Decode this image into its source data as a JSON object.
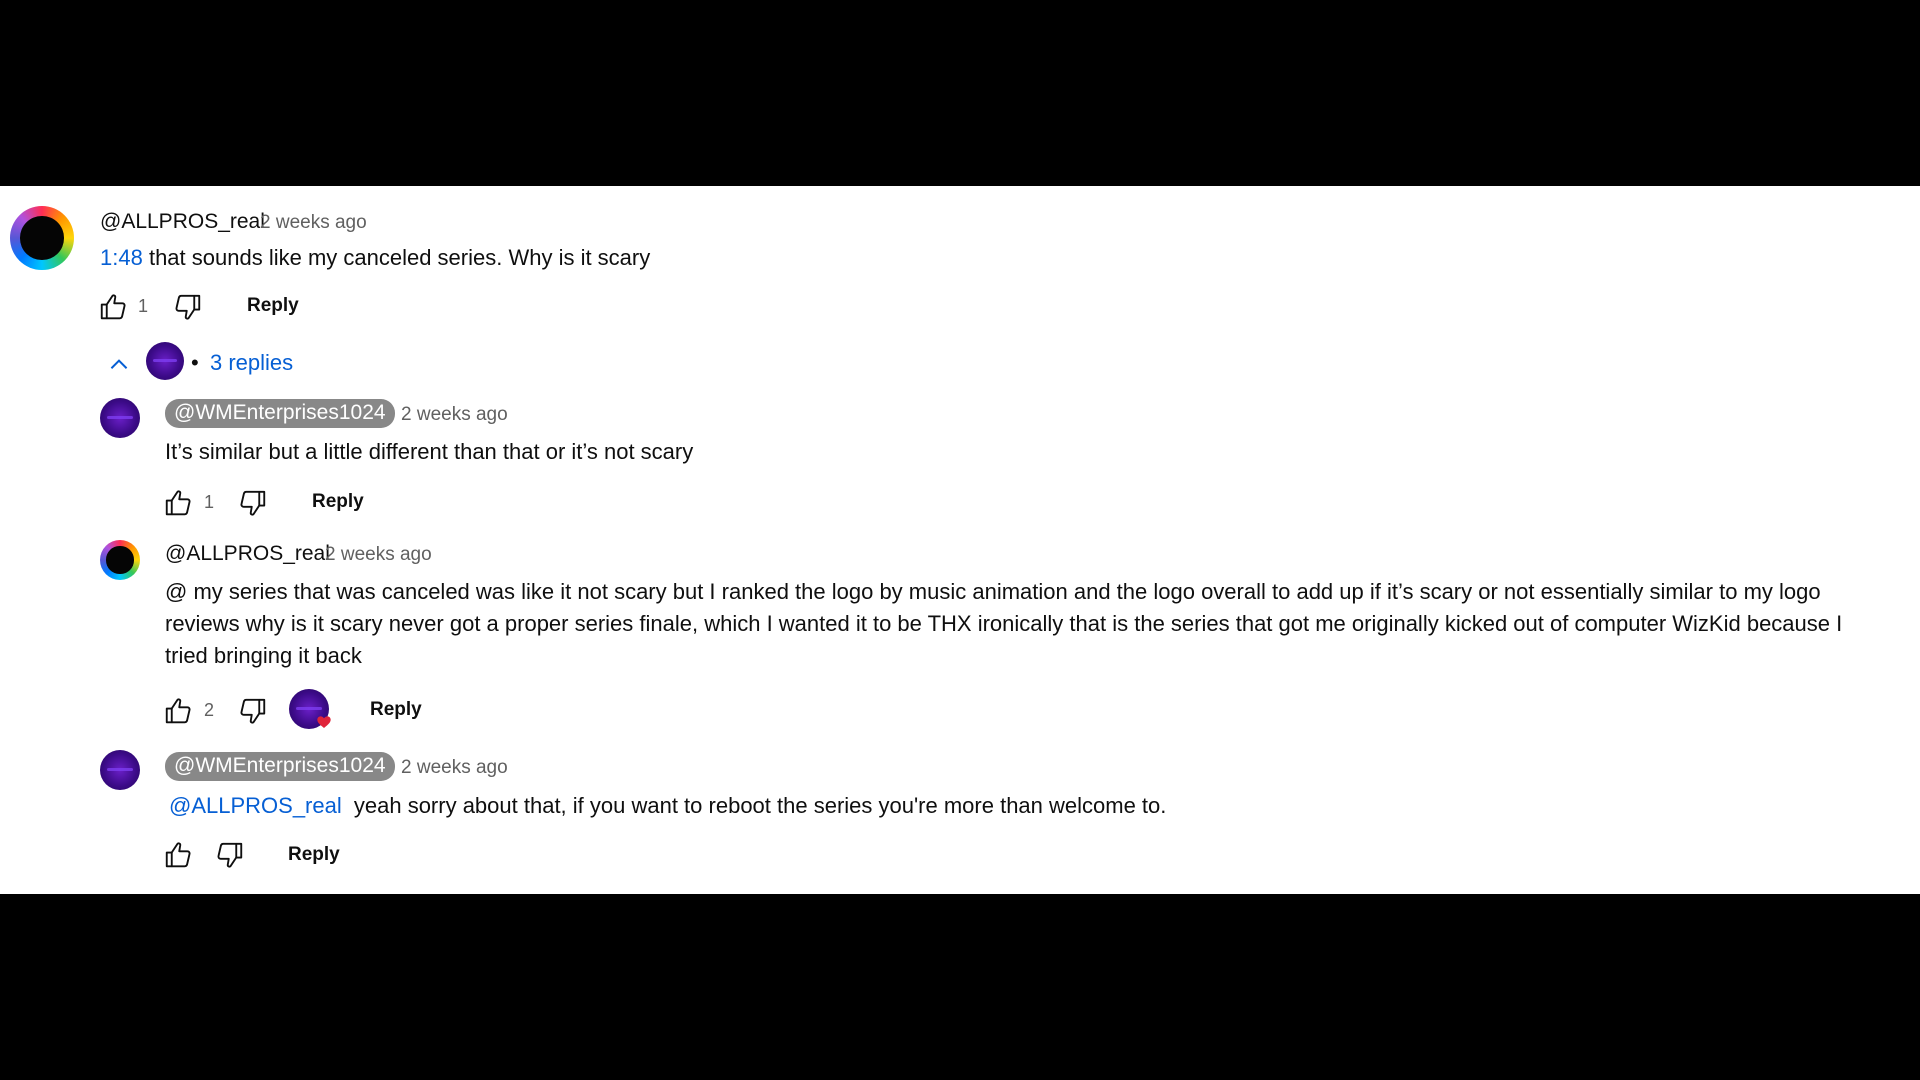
{
  "comment": {
    "author": "@ALLPROS_real",
    "time": "2 weeks ago",
    "timestamp_link": "1:48",
    "text": "that sounds like my canceled series. Why is it scary",
    "likes": "1",
    "reply_label": "Reply"
  },
  "replies_toggle": {
    "label": "3 replies",
    "separator": "•"
  },
  "replies": [
    {
      "author": "@WMEnterprises1024",
      "time": "2 weeks ago",
      "text": "It’s similar but a little different than that or it’s not scary",
      "likes": "1",
      "reply_label": "Reply"
    },
    {
      "author": "@ALLPROS_real",
      "time": "2 weeks ago",
      "text_lines": [
        "@ my series that was canceled was like it not scary but I ranked the logo by music animation and the logo overall to add up if it’s scary or not essentially similar to my logo",
        "reviews why is it scary never got a proper series finale, which I wanted it to be THX ironically that is the series that got me originally kicked out of computer WizKid because I",
        "tried bringing it back"
      ],
      "likes": "2",
      "reply_label": "Reply"
    },
    {
      "author": "@WMEnterprises1024",
      "time": "2 weeks ago",
      "mention": "@ALLPROS_real",
      "text": "yeah sorry about that, if you want to reboot the series you're more than welcome to.",
      "reply_label": "Reply"
    }
  ],
  "colors": {
    "link": "#065fd4",
    "chip_bg": "#888888",
    "heart": "#e0243a"
  },
  "icons": {
    "like": "thumb-up-icon",
    "dislike": "thumb-down-icon",
    "collapse": "chevron-up-icon",
    "heart": "heart-icon"
  }
}
